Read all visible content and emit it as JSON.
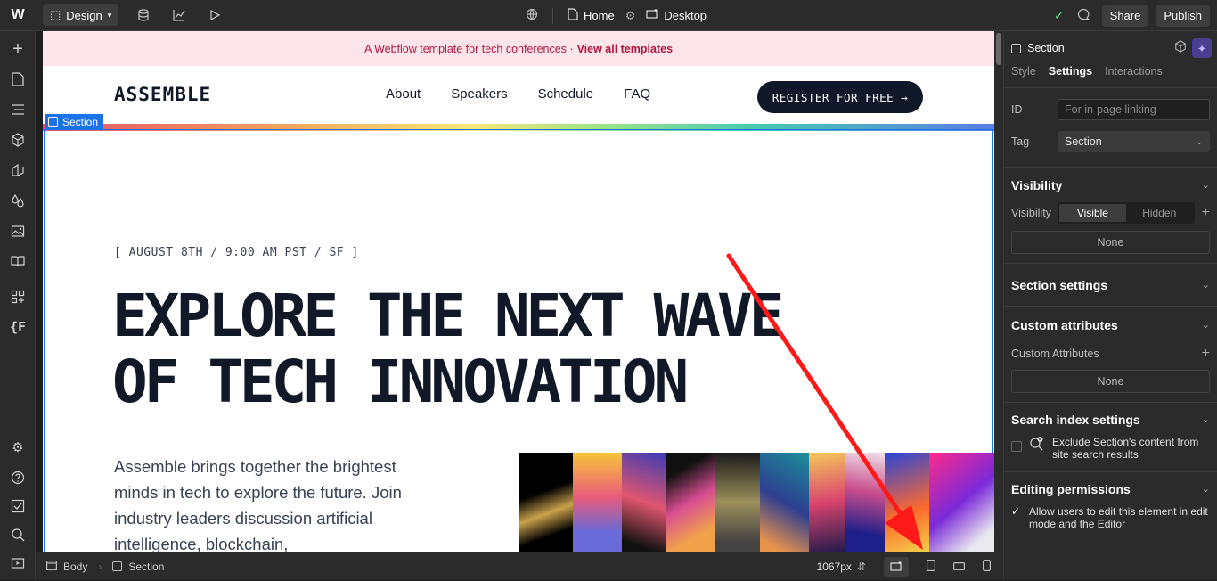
{
  "topbar": {
    "mode_label": "Design",
    "page_label": "Home",
    "breakpoint_label": "Desktop",
    "share_label": "Share",
    "publish_label": "Publish"
  },
  "site": {
    "banner_text": "A Webflow template for tech conferences ·",
    "banner_link": "View all templates",
    "brand": "ASSEMBLE",
    "nav_links": [
      "About",
      "Speakers",
      "Schedule",
      "FAQ"
    ],
    "register_label": "REGISTER FOR FREE →",
    "date_line": "[ AUGUST 8TH / 9:00 AM PST / SF ]",
    "headline_1": "EXPLORE THE NEXT WAVE",
    "headline_2": "OF TECH INNOVATION",
    "paragraph": "Assemble brings together the brightest minds in tech to explore the future. Join industry leaders discussion artificial intelligence, blockchain,"
  },
  "canvas": {
    "selected_tag": "Section"
  },
  "breadcrumb": {
    "items": [
      "Body",
      "Section"
    ],
    "width_readout": "1067px"
  },
  "panel": {
    "element_name": "Section",
    "tabs": [
      "Style",
      "Settings",
      "Interactions"
    ],
    "id_label": "ID",
    "id_placeholder": "For in-page linking",
    "tag_label": "Tag",
    "tag_value": "Section",
    "visibility_title": "Visibility",
    "visibility_label": "Visibility",
    "visible_label": "Visible",
    "hidden_label": "Hidden",
    "visibility_none": "None",
    "section_settings_title": "Section settings",
    "custom_attrs_title": "Custom attributes",
    "custom_attrs_label": "Custom Attributes",
    "custom_attrs_none": "None",
    "search_title": "Search index settings",
    "search_exclude": "Exclude Section's content from site search results",
    "editing_title": "Editing permissions",
    "editing_allow": "Allow users to edit this element in edit mode and the Editor"
  },
  "colors": {
    "accent_blue": "#1a73e8",
    "banner_text": "#b0173f",
    "annotation_arrow": "#ff1a1a"
  }
}
